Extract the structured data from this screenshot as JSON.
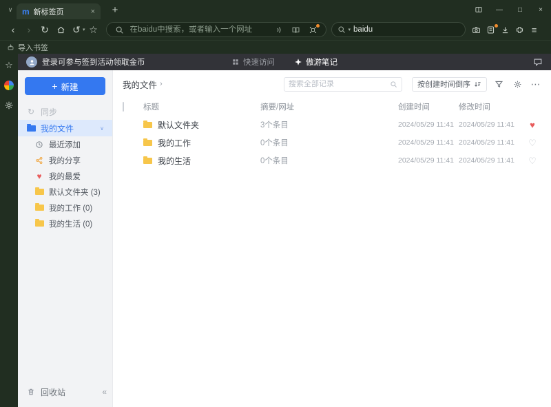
{
  "colors": {
    "accent": "#3478f0",
    "chrome_green": "#212e21",
    "header_dark": "#323338",
    "folder_yellow": "#f7c64a",
    "heart_red": "#e85c5c"
  },
  "icons": {
    "chevron_down": "∨",
    "close": "×",
    "plus": "+",
    "minimize": "—",
    "maximize": "□",
    "back": "‹",
    "forward": "›",
    "refresh": "↻",
    "undo": "↺",
    "caret_down": "▾",
    "star": "☆",
    "menu": "≡",
    "more": "⋯",
    "collapse": "«",
    "breadcrumb_caret": "›",
    "heart_filled": "♥",
    "heart_outline": "♡",
    "logo_letter": "m"
  },
  "titlebar": {
    "tab_title": "新标签页"
  },
  "toolbar": {
    "address_placeholder": "在baidu中搜索，或者输入一个网址",
    "search_value": "baidu"
  },
  "bookmarks_bar": {
    "import_bookmarks": "导入书签"
  },
  "page_header": {
    "login_text": "登录可参与签到活动领取金币",
    "tab_quick_access": "快速访问",
    "tab_notes": "傲游笔记"
  },
  "sidebar": {
    "new_button": "新建",
    "sync": "同步",
    "my_files": "我的文件",
    "items": [
      {
        "label": "最近添加",
        "icon": "clock"
      },
      {
        "label": "我的分享",
        "icon": "share"
      },
      {
        "label": "我的最爱",
        "icon": "heart"
      },
      {
        "label": "默认文件夹 (3)",
        "icon": "folder"
      },
      {
        "label": "我的工作 (0)",
        "icon": "folder"
      },
      {
        "label": "我的生活 (0)",
        "icon": "folder"
      }
    ],
    "recycle_bin": "回收站"
  },
  "main": {
    "breadcrumb": "我的文件",
    "search_placeholder": "搜索全部记录",
    "sort_button": "按创建时间倒序",
    "table": {
      "headers": {
        "title": "标题",
        "summary": "摘要/网址",
        "created": "创建时间",
        "modified": "修改时间"
      },
      "rows": [
        {
          "title": "默认文件夹",
          "summary": "3个条目",
          "created": "2024/05/29 11:41",
          "modified": "2024/05/29 11:41",
          "favorite": true
        },
        {
          "title": "我的工作",
          "summary": "0个条目",
          "created": "2024/05/29 11:41",
          "modified": "2024/05/29 11:41",
          "favorite": false
        },
        {
          "title": "我的生活",
          "summary": "0个条目",
          "created": "2024/05/29 11:41",
          "modified": "2024/05/29 11:41",
          "favorite": false
        }
      ]
    }
  }
}
